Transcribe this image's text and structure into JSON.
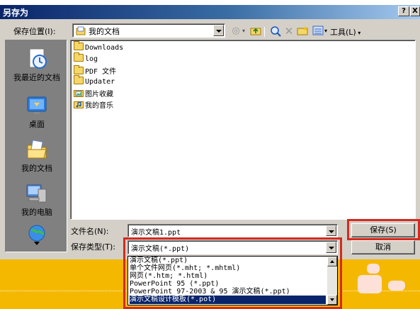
{
  "window": {
    "title": "另存为",
    "help_btn": "?",
    "close_btn": "X"
  },
  "toolbar": {
    "save_in_label": "保存位置(I):",
    "save_in_value": "我的文档",
    "tools_label": "工具(L)"
  },
  "places": [
    {
      "label": "我最近的文档",
      "icon": "recent-documents-icon"
    },
    {
      "label": "桌面",
      "icon": "desktop-icon"
    },
    {
      "label": "我的文档",
      "icon": "my-documents-icon"
    },
    {
      "label": "我的电脑",
      "icon": "my-computer-icon"
    },
    {
      "label": "",
      "icon": "network-places-icon"
    }
  ],
  "files": [
    {
      "name": "Downloads",
      "type": "folder"
    },
    {
      "name": "log",
      "type": "folder"
    },
    {
      "name": "PDF 文件",
      "type": "folder"
    },
    {
      "name": "Updater",
      "type": "folder"
    },
    {
      "name": "图片收藏",
      "type": "pictures"
    },
    {
      "name": "我的音乐",
      "type": "music"
    }
  ],
  "form": {
    "filename_label": "文件名(N):",
    "filename_value": "演示文稿1.ppt",
    "filetype_label": "保存类型(T):",
    "filetype_value": "演示文稿(*.ppt)",
    "save_button": "保存(S)",
    "cancel_button": "取消"
  },
  "filetype_options": [
    "演示文稿(*.ppt)",
    "单个文件网页(*.mht; *.mhtml)",
    "网页(*.htm; *.html)",
    "PowerPoint 95 (*.ppt)",
    "PowerPoint 97-2003 & 95 演示文稿(*.ppt)",
    "演示文稿设计模板(*.pot)"
  ],
  "selected_option_index": 5,
  "colors": {
    "highlight": "#d32b1e",
    "background_orange": "#f5b800",
    "dialog_face": "#d4d0c8",
    "selection": "#0a246a"
  }
}
